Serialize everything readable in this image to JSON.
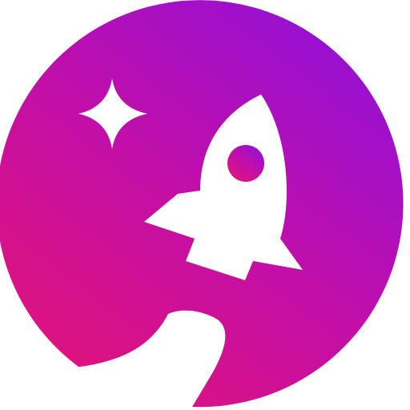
{
  "icon": {
    "name": "rocket-launch-logo",
    "colors": {
      "gradient_start": "#E0137A",
      "gradient_mid": "#C20FA8",
      "gradient_end": "#9410D6",
      "glyph": "#FFFFFF",
      "background": "#FFFFFF"
    },
    "elements": [
      "sparkle-icon",
      "rocket-icon",
      "rocket-window",
      "rocket-trail"
    ]
  }
}
